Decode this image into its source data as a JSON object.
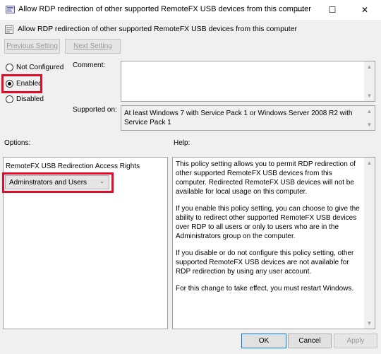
{
  "window": {
    "title": "Allow RDP redirection of other supported RemoteFX USB devices from this computer",
    "minimize": "—",
    "maximize": "☐",
    "close": "✕"
  },
  "header": {
    "title": "Allow RDP redirection of other supported RemoteFX USB devices from this computer"
  },
  "nav": {
    "previous": "Previous Setting",
    "next": "Next Setting"
  },
  "state": {
    "options": [
      "Not Configured",
      "Enabled",
      "Disabled"
    ],
    "selected": "Enabled"
  },
  "comment": {
    "label": "Comment:",
    "value": ""
  },
  "supported": {
    "label": "Supported on:",
    "value": "At least Windows 7 with Service Pack 1 or Windows Server 2008 R2 with Service Pack 1"
  },
  "options_section": {
    "label": "Options:",
    "field_label": "RemoteFX USB Redirection Access Rights",
    "dropdown_value": "Adminstrators and Users"
  },
  "help": {
    "label": "Help:",
    "paragraphs": [
      "This policy setting allows you to permit RDP redirection of other supported RemoteFX USB devices from this computer. Redirected RemoteFX USB devices will not be available for local usage on this computer.",
      "If you enable this policy setting, you can choose to give the ability to redirect other supported RemoteFX USB devices over RDP to all users or only to users who are in the Administrators group on the computer.",
      "If you disable or do not configure this policy setting, other supported RemoteFX USB devices are not available for RDP redirection by using any user account.",
      "For this change to take effect, you must restart Windows."
    ]
  },
  "footer": {
    "ok": "OK",
    "cancel": "Cancel",
    "apply": "Apply"
  },
  "colors": {
    "highlight": "#e00d2a",
    "accent": "#0078d7"
  }
}
